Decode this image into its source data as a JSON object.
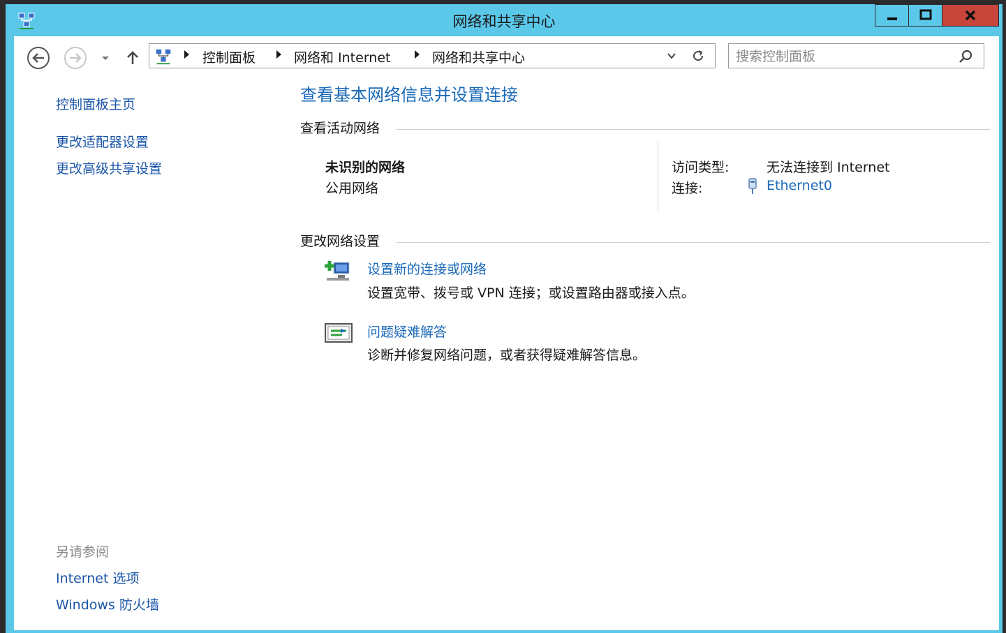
{
  "window": {
    "title": "网络和共享中心",
    "buttons": {
      "minimize": "minimize",
      "maximize": "maximize",
      "close": "close"
    },
    "colors": {
      "frame": "#5bc8ea",
      "close": "#c7453a",
      "link": "#1a6ab8"
    }
  },
  "nav": {
    "breadcrumb": [
      "控制面板",
      "网络和 Internet",
      "网络和共享中心"
    ],
    "search_placeholder": "搜索控制面板"
  },
  "left_pane": {
    "home": "控制面板主页",
    "links": [
      "更改适配器设置",
      "更改高级共享设置"
    ],
    "see_also_title": "另请参阅",
    "see_also": [
      "Internet 选项",
      "Windows 防火墙"
    ]
  },
  "main": {
    "heading": "查看基本网络信息并设置连接",
    "active_title": "查看活动网络",
    "network": {
      "name": "未识别的网络",
      "type": "公用网络",
      "access_label": "访问类型:",
      "access_value": "无法连接到 Internet",
      "conn_label": "连接:",
      "conn_value": "Ethernet0"
    },
    "change_title": "更改网络设置",
    "tasks": [
      {
        "link": "设置新的连接或网络",
        "desc": "设置宽带、拨号或 VPN 连接；或设置路由器或接入点。"
      },
      {
        "link": "问题疑难解答",
        "desc": "诊断并修复网络问题，或者获得疑难解答信息。"
      }
    ]
  }
}
